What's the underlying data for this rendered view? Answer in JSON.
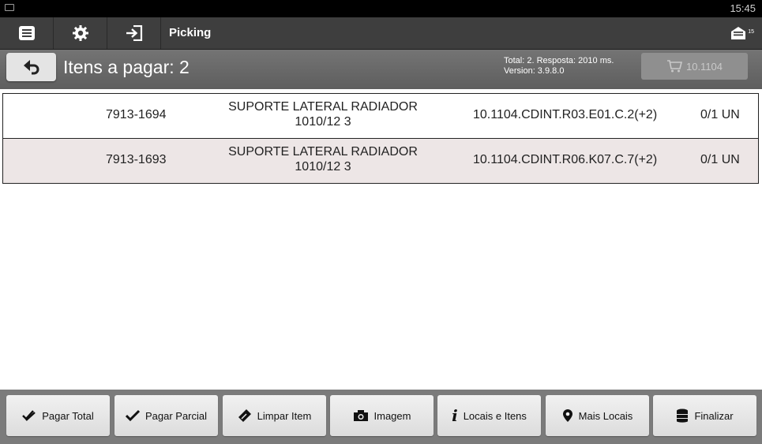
{
  "status_bar": {
    "time": "15:45"
  },
  "action_bar": {
    "title": "Picking",
    "message_count": "15"
  },
  "header": {
    "title": "Itens a pagar: 2",
    "info_line1": "Total: 2. Resposta: 2010 ms.",
    "info_line2": "Version: 3.9.8.0",
    "cart_label": "10.1104"
  },
  "items": [
    {
      "code": "7913-1694",
      "desc_line1": "SUPORTE LATERAL RADIADOR",
      "desc_line2": "1010/12 3",
      "location": "10.1104.CDINT.R03.E01.C.2(+2)",
      "qty": "0/1 UN"
    },
    {
      "code": "7913-1693",
      "desc_line1": "SUPORTE LATERAL RADIADOR",
      "desc_line2": "1010/12 3",
      "location": "10.1104.CDINT.R06.K07.C.7(+2)",
      "qty": "0/1 UN"
    }
  ],
  "bottom_buttons": {
    "pagar_total": "Pagar Total",
    "pagar_parcial": "Pagar Parcial",
    "limpar_item": "Limpar Item",
    "imagem": "Imagem",
    "locais_itens": "Locais e Itens",
    "mais_locais": "Mais Locais",
    "finalizar": "Finalizar"
  }
}
